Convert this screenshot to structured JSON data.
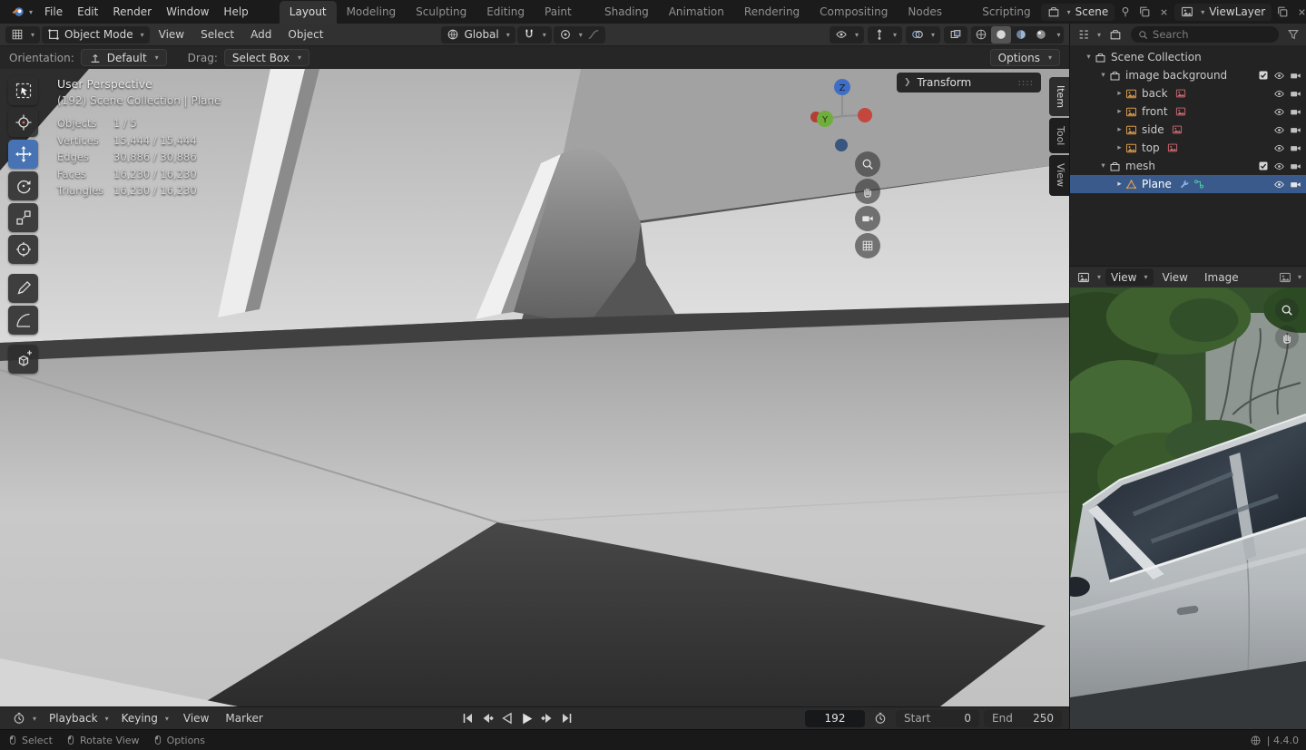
{
  "topbar": {
    "menus": [
      "File",
      "Edit",
      "Render",
      "Window",
      "Help"
    ],
    "workspaces": [
      "Layout",
      "Modeling",
      "Sculpting",
      "UV Editing",
      "Texture Paint",
      "Shading",
      "Animation",
      "Rendering",
      "Compositing",
      "Geometry Nodes",
      "Scripting"
    ],
    "scene_label": "Scene",
    "viewlayer_label": "ViewLayer"
  },
  "viewport_header": {
    "mode": "Object Mode",
    "menu_view": "View",
    "menu_select": "Select",
    "menu_add": "Add",
    "menu_object": "Object",
    "orientation": "Global"
  },
  "tool_settings": {
    "orientation_label": "Orientation:",
    "orientation_value": "Default",
    "drag_label": "Drag:",
    "drag_value": "Select Box",
    "options_label": "Options"
  },
  "viewport": {
    "perspective_label": "User Perspective",
    "context_label": "(192) Scene Collection | Plane",
    "stats": {
      "objects_label": "Objects",
      "objects_value": "1 / 5",
      "vertices_label": "Vertices",
      "vertices_value": "15,444 / 15,444",
      "edges_label": "Edges",
      "edges_value": "30,886 / 30,886",
      "faces_label": "Faces",
      "faces_value": "16,230 / 16,230",
      "triangles_label": "Triangles",
      "triangles_value": "16,230 / 16,230"
    },
    "transform_panel_label": "Transform",
    "side_tabs": {
      "item": "Item",
      "tool": "Tool",
      "view": "View"
    },
    "gizmo": {
      "z": "Z",
      "y": "Y"
    }
  },
  "outliner": {
    "search_placeholder": "Search",
    "rows": {
      "scene_collection": "Scene Collection",
      "image_background": "image background",
      "back": "back",
      "front": "front",
      "side": "side",
      "top": "top",
      "mesh": "mesh",
      "plane": "Plane"
    }
  },
  "image_editor": {
    "view_selector": "View",
    "menu_view": "View",
    "menu_image": "Image"
  },
  "timeline": {
    "playback": "Playback",
    "keying": "Keying",
    "menu_view": "View",
    "menu_marker": "Marker",
    "current_frame": "192",
    "start_label": "Start",
    "start_value": "0",
    "end_label": "End",
    "end_value": "250"
  },
  "statusbar": {
    "select": "Select",
    "rotate_view": "Rotate View",
    "options": "Options",
    "version": "| 4.4.0"
  },
  "colors": {
    "accent": "#4772b3",
    "selected_row": "#3a5a8c"
  }
}
